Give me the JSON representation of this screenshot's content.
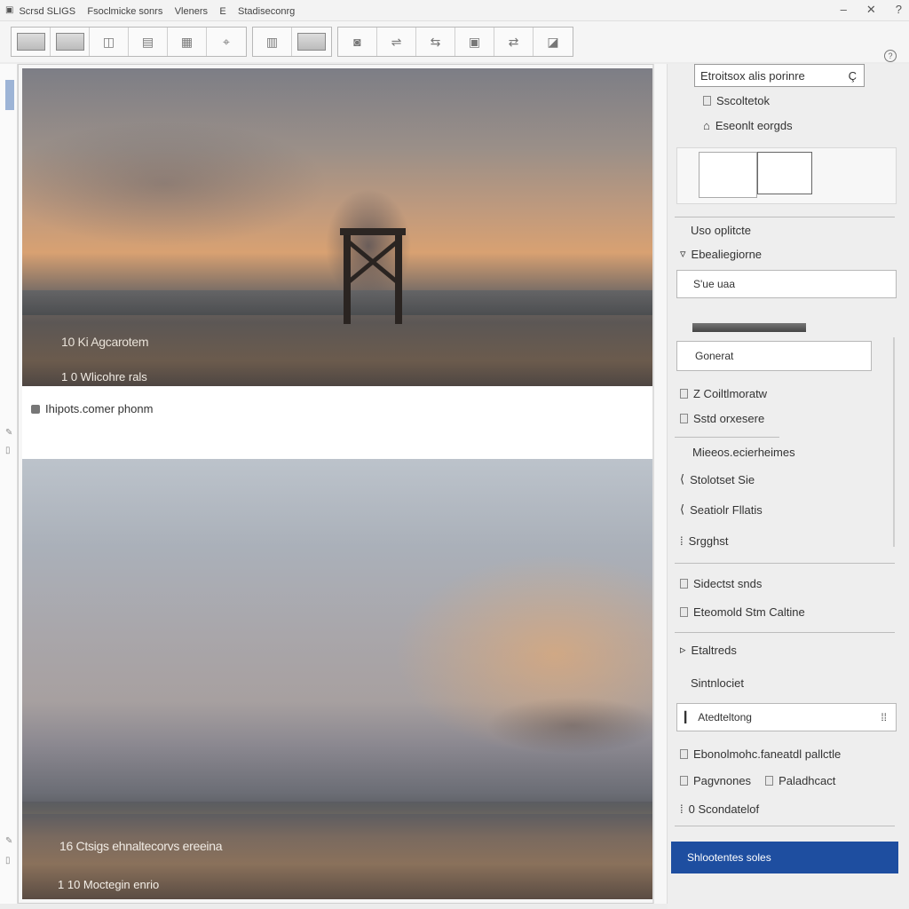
{
  "window": {
    "title_items": [
      "Scrsd SLIGS",
      "Fsoclmicke sonrs",
      "Vleners",
      "E",
      "Stadiseconrg"
    ],
    "controls": [
      "–",
      "✕",
      "?"
    ]
  },
  "toolbar": {
    "help": "?"
  },
  "canvas": {
    "photo1_caption_1": "10 Ki Agcarotem",
    "photo1_caption_2": "1 0 Wlicohre rals",
    "band_text": "Ihipots.comer phonm",
    "photo2_caption_1": "16 Ctsigs ehnaltecorvs ereeina",
    "photo2_caption_2": "1 10 Moctegin enrio"
  },
  "panel": {
    "search_value": "Etroitsox alis porinre",
    "search_icon_text": "Ç",
    "item_a": "Sscoltetok",
    "item_b": "Eseonlt eorgds",
    "section_1": "Uso oplitcte",
    "item_c": "Ebealiegiorne",
    "field_1": "S'ue uaa",
    "field_2": "Gonerat",
    "item_d": "Z Coiltlmoratw",
    "item_e": "Sstd orxesere",
    "item_f": "Mieeos.ecierheimes",
    "item_g": "Stolotset Sie",
    "item_h": "Seatiolr Fllatis",
    "item_i": "Srgghst",
    "item_j": "Sidectst snds",
    "item_k": "Eteomold  Stm Caltine",
    "item_l": "Etaltreds",
    "item_m": "Sintnlociet",
    "field_3": "Atedteltong",
    "item_n": "Ebonolmohc.faneatdl pallctle",
    "item_o1": "Pagvnones",
    "item_o2": "Paladhcact",
    "item_p": "0 Scondatelof",
    "primary_button": "Shlootentes soles"
  }
}
